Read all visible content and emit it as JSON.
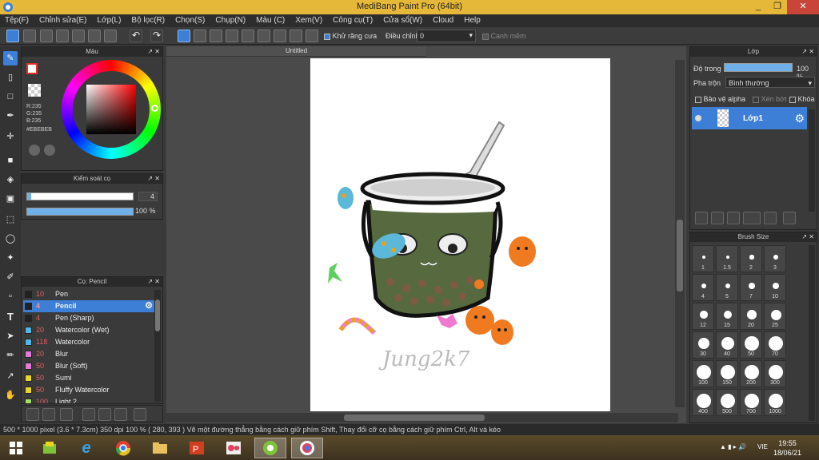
{
  "window": {
    "title": "MediBang Paint Pro (64bit)",
    "controls": [
      "_",
      "❐",
      "✕"
    ]
  },
  "menu": [
    "Tệp(F)",
    "Chỉnh sửa(E)",
    "Lớp(L)",
    "Bộ lọc(R)",
    "Chọn(S)",
    "Chụp(N)",
    "Màu (C)",
    "Xem(V)",
    "Công cụ(T)",
    "Cửa sổ(W)",
    "Cloud",
    "Help"
  ],
  "toolbar": {
    "antialias_label": "Khử răng cưa",
    "adjust_label": "Điều chỉnh",
    "adjust_value": "0",
    "edge_label": "Canh mềm"
  },
  "color_panel": {
    "title": "Màu",
    "r": "R:235",
    "g": "G:235",
    "b": "B:235",
    "hex": "#EBEBEB"
  },
  "brush_control": {
    "title": "Kiểm soát cọ",
    "size": "4",
    "opacity": "100 %",
    "size_fraction": 0.04,
    "opacity_fraction": 1.0
  },
  "brush_list": {
    "title": "Cọ: Pencil",
    "items": [
      {
        "size": "10",
        "name": "Pen",
        "color": "#222222"
      },
      {
        "size": "4",
        "name": "Pencil",
        "color": "#222222"
      },
      {
        "size": "4",
        "name": "Pen (Sharp)",
        "color": "#222222"
      },
      {
        "size": "20",
        "name": "Watercolor (Wet)",
        "color": "#4fb8e8"
      },
      {
        "size": "118",
        "name": "Watercolor",
        "color": "#4fb8e8"
      },
      {
        "size": "20",
        "name": "Blur",
        "color": "#e57ad6"
      },
      {
        "size": "50",
        "name": "Blur (Soft)",
        "color": "#e57ad6"
      },
      {
        "size": "50",
        "name": "Sumi",
        "color": "#e8d620"
      },
      {
        "size": "50",
        "name": "Fluffy Watercolor",
        "color": "#e8d620"
      },
      {
        "size": "100",
        "name": "Light 2",
        "color": "#a8e060"
      }
    ]
  },
  "canvas": {
    "tab": "Untitled",
    "signature": "Jung2k7"
  },
  "layer_panel": {
    "title": "Lớp",
    "opacity_label": "Độ trong",
    "opacity_value": "100 %",
    "blend_label": "Pha trộn",
    "blend_value": "Bình thường",
    "protect_alpha": "Bảo vệ alpha",
    "clip": "Xén bớt",
    "lock": "Khóa",
    "layer_name": "Lớp1"
  },
  "brush_size_panel": {
    "title": "Brush Size",
    "sizes": [
      "1",
      "1.5",
      "2",
      "3",
      "4",
      "5",
      "7",
      "10",
      "12",
      "15",
      "20",
      "25",
      "30",
      "40",
      "50",
      "70",
      "100",
      "150",
      "200",
      "300",
      "400",
      "500",
      "700",
      "1000"
    ]
  },
  "status": "500 * 1000 pixel   (3.6 * 7.3cm)   350 dpi   100 %   ( 280, 393 )   Vẽ một đường thẳng bằng cách giữ phím Shift, Thay đổi cỡ cọ bằng cách giữ phím Ctrl, Alt và kéo",
  "taskbar": {
    "lang": "VIE",
    "time": "19:55",
    "date": "18/06/21"
  }
}
